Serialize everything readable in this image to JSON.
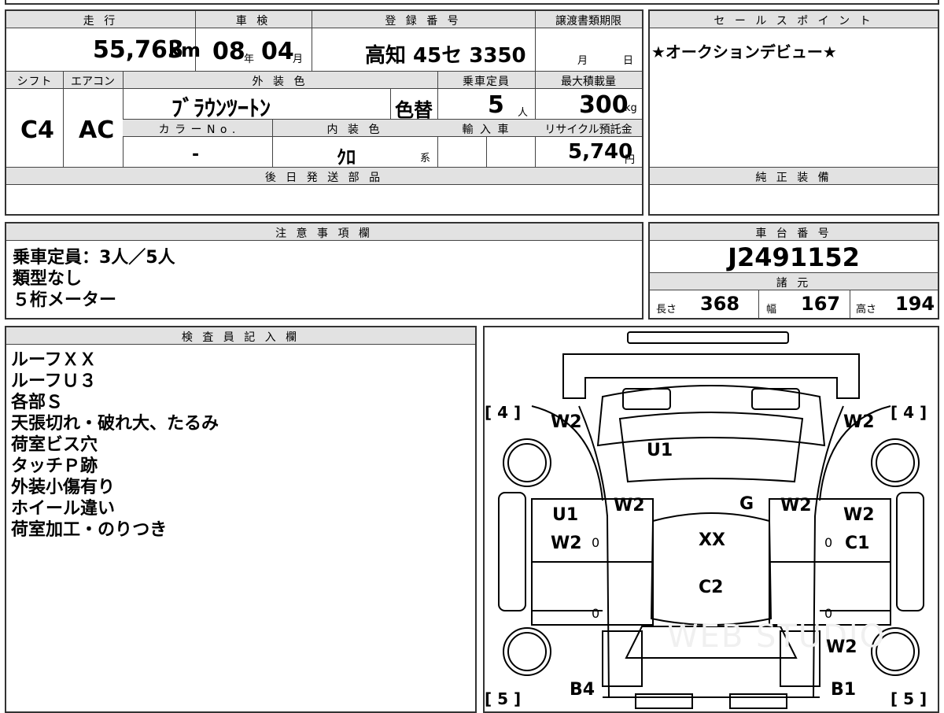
{
  "top": {
    "headers": {
      "mileage": "走 行",
      "inspection": "車 検",
      "registration": "登 録 番 号",
      "transfer_deadline": "譲渡書類期限",
      "shift": "シフト",
      "aircon": "エアコン",
      "exterior_color": "外 装 色",
      "capacity": "乗車定員",
      "max_load": "最大積載量",
      "color_no": "カ ラ ー N o .",
      "interior_color": "内 装 色",
      "import": "輸 入 車",
      "recycle_fee": "リサイクル預託金",
      "later_parts": "後 日 発 送 部 品"
    },
    "mileage_value": "55,763",
    "mileage_unit": "km",
    "inspection_year": "08",
    "inspection_year_unit": "年",
    "inspection_month": "04",
    "inspection_month_unit": "月",
    "registration_value": "高知 45セ 3350",
    "transfer_month_unit": "月",
    "transfer_day_unit": "日",
    "shift_value": "C4",
    "aircon_value": "AC",
    "exterior_color_value": "ﾌﾞﾗｳﾝﾂｰﾄﾝ",
    "color_change": "色替",
    "capacity_value": "5",
    "capacity_unit": "人",
    "max_load_value": "300",
    "max_load_unit": "kg",
    "color_no_value": "-",
    "interior_color_value": "ｸﾛ",
    "interior_color_suffix": "系",
    "recycle_value": "5,740",
    "recycle_unit": "円"
  },
  "sales_point": {
    "header": "セ ー ル ス ポ イ ン ト",
    "text": "★オークションデビュー★"
  },
  "genuine_equipment": {
    "header": "純 正 装 備"
  },
  "notes": {
    "header": "注 意 事 項 欄",
    "lines": [
      "乗車定員：3人／5人",
      "類型なし",
      "５桁メーター"
    ]
  },
  "chassis": {
    "header": "車 台 番 号",
    "value": "J2491152"
  },
  "specs": {
    "header": "諸 元",
    "length_label": "長さ",
    "length_value": "368",
    "width_label": "幅",
    "width_value": "167",
    "height_label": "高さ",
    "height_value": "194"
  },
  "inspector": {
    "header": "検 査 員 記 入 欄",
    "lines": [
      "ルーフＸＸ",
      "ルーフＵ３",
      "各部Ｓ",
      "天張切れ・破れ大、たるみ",
      "荷室ビス穴",
      "タッチＰ跡",
      "外装小傷有り",
      "ホイール違い",
      "荷室加工・のりつき"
    ]
  },
  "diagram": {
    "marks": {
      "roof_front": "U1",
      "front_left": "W2",
      "front_right": "W2",
      "pillar_left": "W2",
      "pillar_right": "W2",
      "glass": "G",
      "left_door_front_1": "U1",
      "left_door_front_2": "W2",
      "right_door_front_1": "W2",
      "right_door_front_2": "C1",
      "roof_center_1": "XX",
      "roof_center_2": "C2",
      "rear_right_1": "W2",
      "rear_left_bottom": "B4",
      "rear_right_bottom": "B1",
      "zero": "0"
    },
    "tire_front_left": "[ 4 ]",
    "tire_front_right": "[ 4 ]",
    "tire_rear_left": "[ 5 ]",
    "tire_rear_right": "[ 5 ]",
    "watermark": "WEB STUDIO"
  }
}
